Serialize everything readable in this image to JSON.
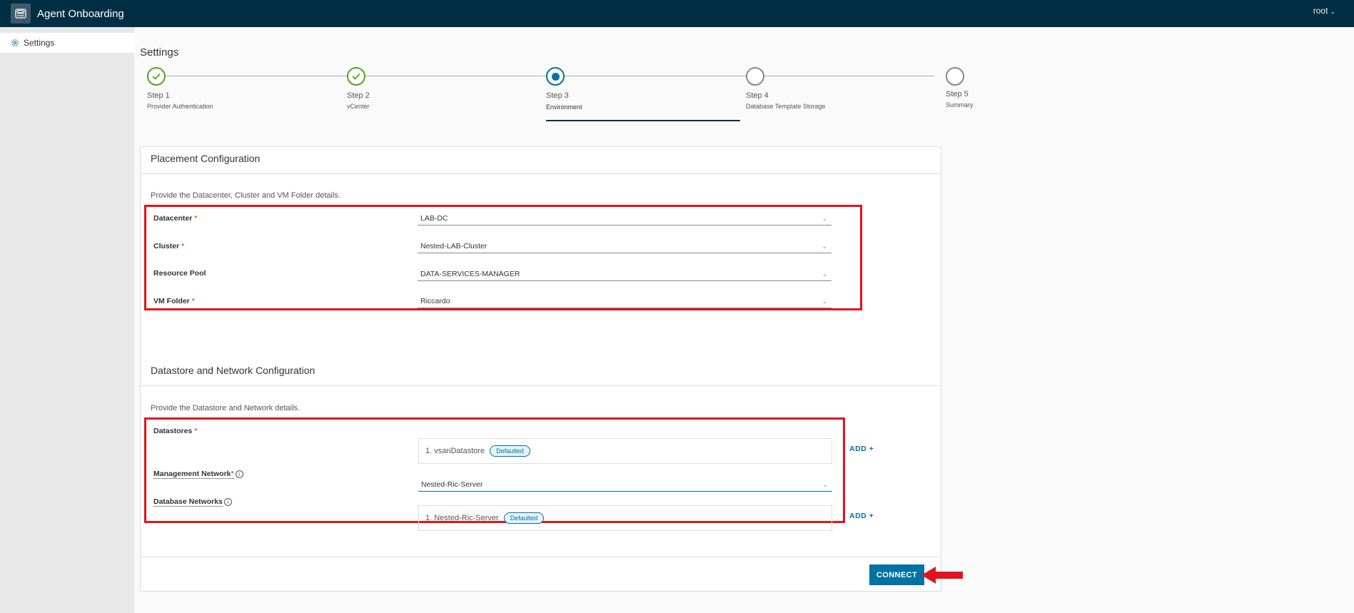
{
  "header": {
    "app_title": "Agent Onboarding",
    "user": "root",
    "bg_color": "#002e44"
  },
  "sidebar": {
    "items": [
      {
        "label": "Settings",
        "icon": "gear-icon"
      }
    ]
  },
  "page": {
    "title": "Settings"
  },
  "stepper": {
    "steps": [
      {
        "label": "Step 1",
        "sub": "Provider Authentication",
        "state": "done"
      },
      {
        "label": "Step 2",
        "sub": "vCenter",
        "state": "done"
      },
      {
        "label": "Step 3",
        "sub": "Environment",
        "state": "current"
      },
      {
        "label": "Step 4",
        "sub": "Database Template Storage",
        "state": "todo"
      },
      {
        "label": "Step 5",
        "sub": "Summary",
        "state": "todo"
      }
    ]
  },
  "placement": {
    "title": "Placement Configuration",
    "description": "Provide the Datacenter, Cluster and VM Folder details.",
    "fields": [
      {
        "label": "Datacenter",
        "required": "*",
        "value": "LAB-DC"
      },
      {
        "label": "Cluster",
        "required": "*",
        "value": "Nested-LAB-Cluster"
      },
      {
        "label": "Resource Pool",
        "required": "",
        "value": "DATA-SERVICES-MANAGER"
      },
      {
        "label": "VM Folder",
        "required": "*",
        "value": "Riccardo"
      }
    ]
  },
  "network": {
    "title": "Datastore and Network Configuration",
    "description": "Provide the Datastore and Network details.",
    "datastores": {
      "label": "Datastores",
      "required": "*",
      "item": "1. vsanDatastore",
      "badge": "Defaulted",
      "add": "ADD +"
    },
    "management": {
      "label": "Management Network",
      "required": "*",
      "value": "Nested-Ric-Server"
    },
    "database": {
      "label": "Database Networks",
      "item": "1. Nested-Ric-Server",
      "badge": "Defaulted",
      "add": "ADD +"
    }
  },
  "actions": {
    "connect": "CONNECT"
  },
  "colors": {
    "accent": "#0072a3",
    "success": "#5aa220",
    "highlight": "#e0141e"
  }
}
